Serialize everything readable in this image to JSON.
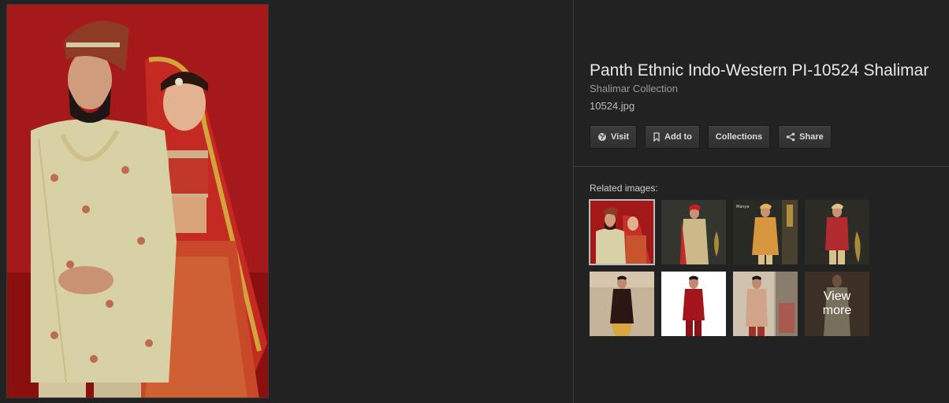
{
  "detail": {
    "title": "Panth Ethnic Indo-Western PI-10524 Shalimar",
    "subtitle": "Shalimar Collection",
    "filename": "10524.jpg"
  },
  "actions": {
    "visit": "Visit",
    "add_to": "Add to",
    "collections": "Collections",
    "share": "Share"
  },
  "related": {
    "label": "Related images:",
    "view_more": "View more"
  },
  "icons": [
    "globe-icon",
    "bookmark-icon",
    "share-icon"
  ],
  "colors": {
    "background": "#222222",
    "button": "#333333",
    "text": "#e6e6e6",
    "muted": "#9a9a9a"
  }
}
